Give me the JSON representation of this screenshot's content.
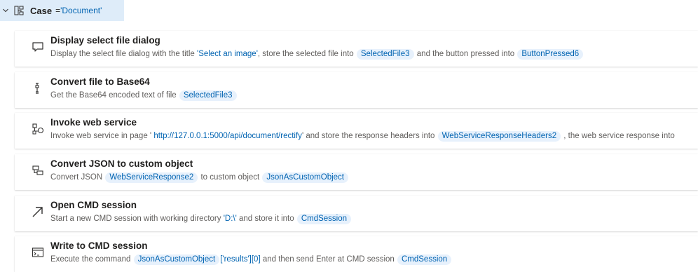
{
  "case": {
    "keyword": "Case",
    "equals": "=",
    "value": "'Document'"
  },
  "actions": [
    {
      "title": "Display select file dialog",
      "icon": "dialog-icon",
      "desc": [
        {
          "t": "text",
          "v": "Display the select file dialog with the title "
        },
        {
          "t": "str",
          "v": "'Select an image'"
        },
        {
          "t": "text",
          "v": ", store the selected file into "
        },
        {
          "t": "var",
          "v": "SelectedFile3"
        },
        {
          "t": "text",
          "v": " and the button pressed into "
        },
        {
          "t": "var",
          "v": "ButtonPressed6"
        }
      ]
    },
    {
      "title": "Convert file to Base64",
      "icon": "convert-file-icon",
      "desc": [
        {
          "t": "text",
          "v": "Get the Base64 encoded text of file "
        },
        {
          "t": "var",
          "v": "SelectedFile3"
        }
      ]
    },
    {
      "title": "Invoke web service",
      "icon": "web-service-icon",
      "desc": [
        {
          "t": "text",
          "v": "Invoke web service in page ' "
        },
        {
          "t": "str",
          "v": "http://127.0.0.1:5000/api/document/rectify"
        },
        {
          "t": "text",
          "v": "' and store the response headers into "
        },
        {
          "t": "var",
          "v": "WebServiceResponseHeaders2"
        },
        {
          "t": "text",
          "v": " , the web service response into "
        }
      ]
    },
    {
      "title": "Convert JSON to custom object",
      "icon": "json-object-icon",
      "desc": [
        {
          "t": "text",
          "v": "Convert JSON "
        },
        {
          "t": "var",
          "v": "WebServiceResponse2"
        },
        {
          "t": "text",
          "v": " to custom object "
        },
        {
          "t": "var",
          "v": "JsonAsCustomObject"
        }
      ]
    },
    {
      "title": "Open CMD session",
      "icon": "open-arrow-icon",
      "desc": [
        {
          "t": "text",
          "v": "Start a new CMD session with working directory "
        },
        {
          "t": "str",
          "v": "'D:\\'"
        },
        {
          "t": "text",
          "v": " and store it into "
        },
        {
          "t": "var",
          "v": "CmdSession"
        }
      ]
    },
    {
      "title": "Write to CMD session",
      "icon": "cmd-window-icon",
      "desc": [
        {
          "t": "text",
          "v": "Execute the command "
        },
        {
          "t": "var",
          "v": "JsonAsCustomObject"
        },
        {
          "t": "str",
          "v": "['results'][0]"
        },
        {
          "t": "text",
          "v": " and then send Enter at CMD session "
        },
        {
          "t": "var",
          "v": "CmdSession"
        }
      ]
    }
  ]
}
